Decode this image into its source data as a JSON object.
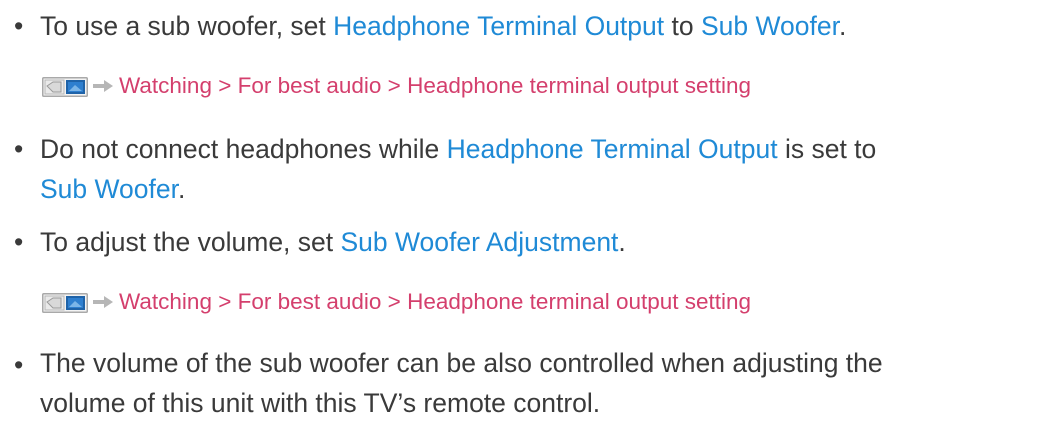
{
  "items": [
    {
      "bullet": "•",
      "parts": [
        {
          "text": "To use a sub woofer, set ",
          "link": false
        },
        {
          "text": "Headphone Terminal Output",
          "link": true
        },
        {
          "text": " to ",
          "link": false
        },
        {
          "text": "Sub Woofer",
          "link": true
        },
        {
          "text": ".",
          "link": false
        }
      ]
    },
    {
      "bullet": "•",
      "line1": [
        {
          "text": "Do not connect headphones while ",
          "link": false
        },
        {
          "text": "Headphone Terminal Output",
          "link": true
        },
        {
          "text": " is set to",
          "link": false
        }
      ],
      "line2": [
        {
          "text": "Sub Woofer",
          "link": true
        },
        {
          "text": ".",
          "link": false
        }
      ]
    },
    {
      "bullet": "•",
      "parts": [
        {
          "text": "To adjust the volume, set ",
          "link": false
        },
        {
          "text": "Sub Woofer Adjustment",
          "link": true
        },
        {
          "text": ".",
          "link": false
        }
      ]
    },
    {
      "bullet": "•",
      "line1": "The volume of the sub woofer can be also controlled when adjusting the",
      "line2": "volume of this unit with this TV’s remote control."
    }
  ],
  "references": [
    {
      "path": "Watching > For best audio > Headphone terminal output setting",
      "icon": "tv-manual-icon",
      "arrow": "arrow-right-icon"
    },
    {
      "path": "Watching > For best audio > Headphone terminal output setting",
      "icon": "tv-manual-icon",
      "arrow": "arrow-right-icon"
    }
  ],
  "colors": {
    "text": "#3a3a3a",
    "link": "#1f8ad6",
    "reference": "#d43f6d"
  }
}
